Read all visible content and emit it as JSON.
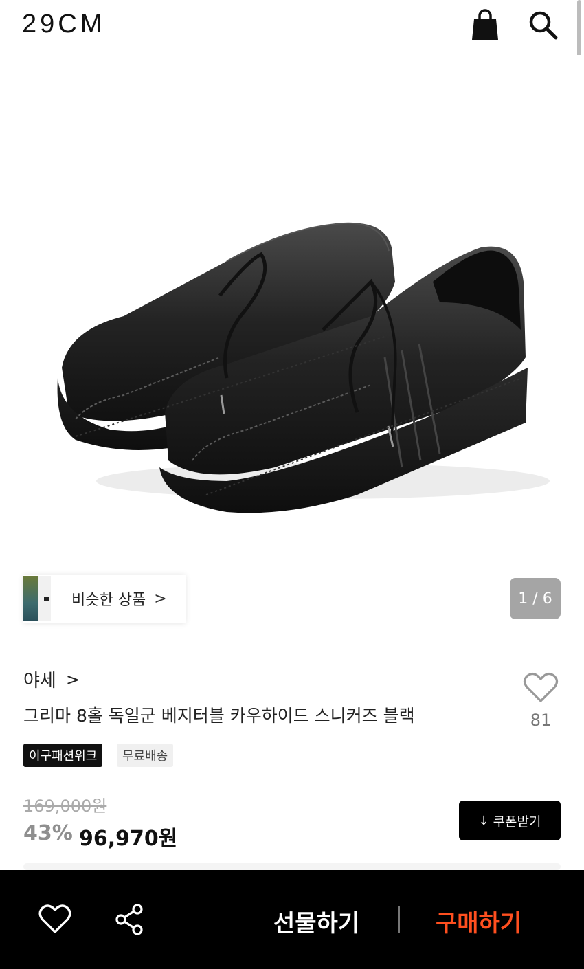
{
  "header": {
    "logo": "29CM"
  },
  "gallery": {
    "similar_label": "비슷한 상품",
    "similar_chevron": ">",
    "page_indicator": "1 / 6"
  },
  "product": {
    "brand": "야세",
    "brand_chevron": ">",
    "name": "그리마 8홀 독일군 베지터블 카우하이드 스니커즈 블랙",
    "likes": "81",
    "badges": [
      "이구패션위크",
      "무료배송"
    ],
    "original_price": "169,000원",
    "discount": "43%",
    "sale_price": "96,970원",
    "coupon_label": "쿠폰받기",
    "coupon_icon": "↓"
  },
  "bottom_bar": {
    "gift_label": "선물하기",
    "buy_label": "구매하기"
  },
  "colors": {
    "accent": "#ff4f1f",
    "bar": "#000000",
    "indicator": "#a5a5a5"
  },
  "icons": {
    "bag": "shopping-bag-icon",
    "search": "search-icon",
    "like": "heart-icon",
    "share": "share-icon"
  }
}
